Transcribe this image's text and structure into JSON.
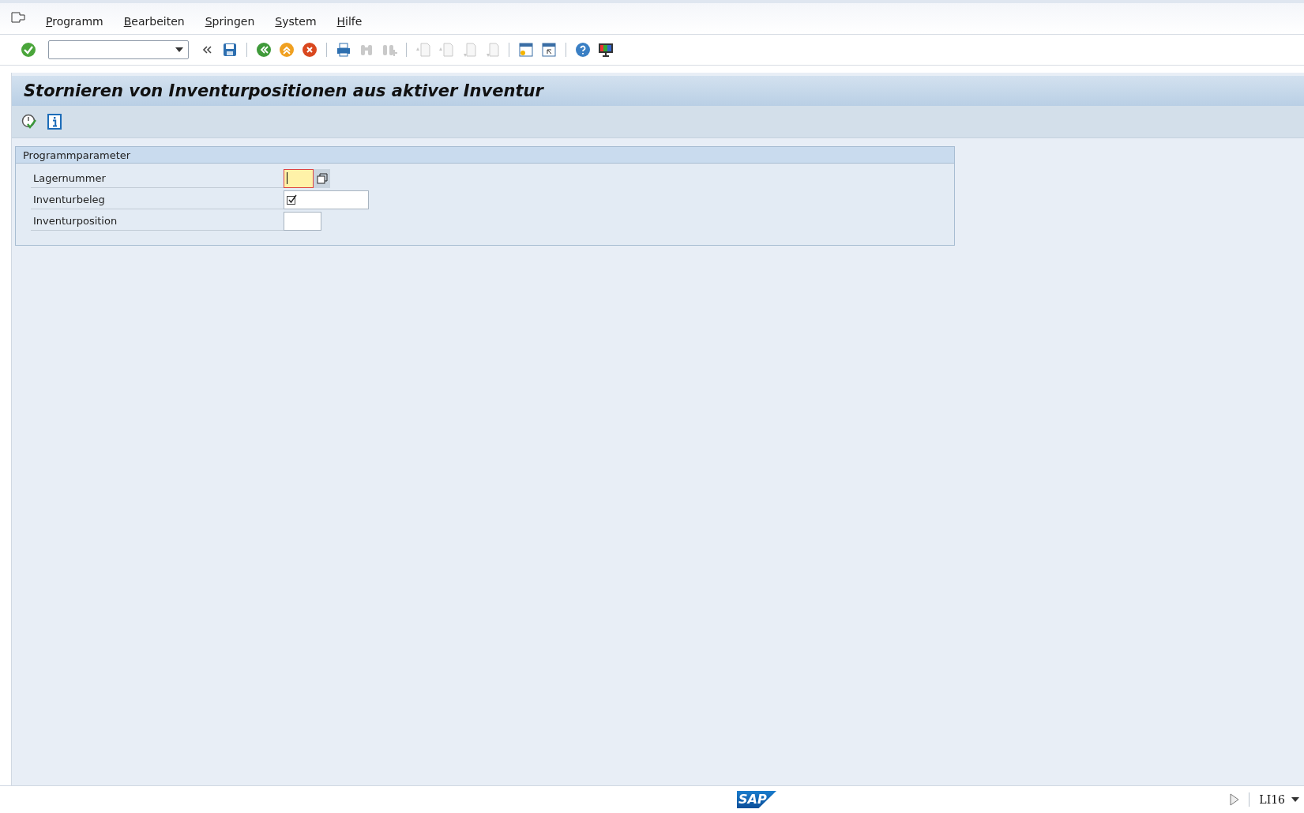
{
  "menu": [
    {
      "label": "Programm"
    },
    {
      "label": "Bearbeiten"
    },
    {
      "label": "Springen"
    },
    {
      "label": "System"
    },
    {
      "label": "Hilfe"
    }
  ],
  "system_toolbar": [
    {
      "buttons": [
        {
          "kind": "enter",
          "disabled": false
        }
      ]
    },
    {
      "buttons": [
        {
          "kind": "collapse",
          "disabled": false
        },
        {
          "kind": "save",
          "disabled": false
        }
      ]
    },
    {
      "buttons": [
        {
          "kind": "back",
          "disabled": false
        },
        {
          "kind": "exit",
          "disabled": false
        },
        {
          "kind": "cancel",
          "disabled": false
        }
      ]
    },
    {
      "buttons": [
        {
          "kind": "print",
          "disabled": false
        },
        {
          "kind": "find",
          "disabled": true
        },
        {
          "kind": "findnext",
          "disabled": true
        }
      ]
    },
    {
      "buttons": [
        {
          "kind": "first",
          "disabled": true
        },
        {
          "kind": "prev",
          "disabled": true
        },
        {
          "kind": "next",
          "disabled": true
        },
        {
          "kind": "last",
          "disabled": true
        }
      ]
    },
    {
      "buttons": [
        {
          "kind": "session",
          "disabled": false
        },
        {
          "kind": "shortcut",
          "disabled": false
        }
      ]
    },
    {
      "buttons": [
        {
          "kind": "help",
          "disabled": false
        },
        {
          "kind": "layout",
          "disabled": false
        }
      ]
    }
  ],
  "title": "Stornieren von Inventurpositionen aus aktiver Inventur",
  "app_toolbar": [
    {
      "kind": "execute"
    },
    {
      "kind": "info"
    }
  ],
  "group": {
    "title": "Programmparameter",
    "fields": [
      {
        "label": "Lagernummer",
        "focused": true,
        "matchcode": true,
        "required": false
      },
      {
        "label": "Inventurbeleg",
        "focused": false,
        "matchcode": false,
        "required": true
      },
      {
        "label": "Inventurposition",
        "focused": false,
        "matchcode": false,
        "required": false
      }
    ]
  },
  "status_bar": {
    "logo": "SAP",
    "transaction": "LI16"
  }
}
